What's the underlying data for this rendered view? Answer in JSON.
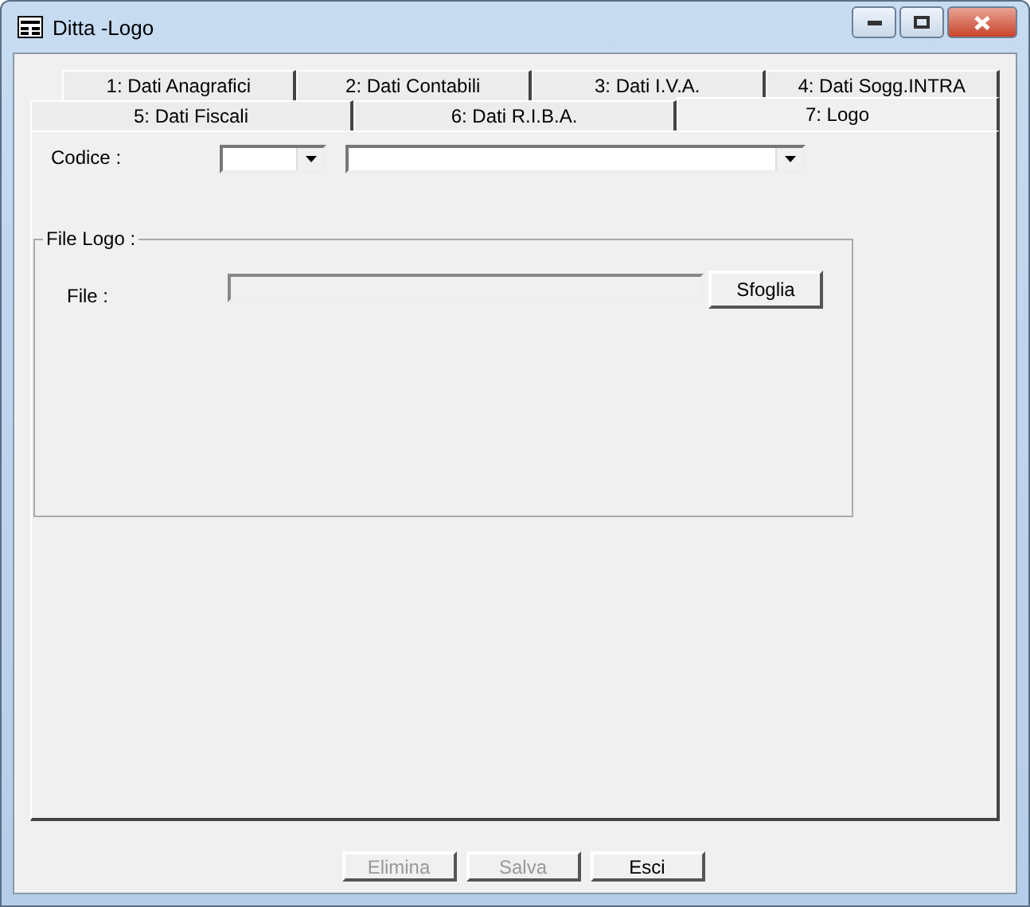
{
  "window": {
    "title": "Ditta -Logo"
  },
  "tab_rows": [
    [
      {
        "label": "1: Dati Anagrafici",
        "selected": false
      },
      {
        "label": "2: Dati Contabili",
        "selected": false
      },
      {
        "label": "3: Dati I.V.A.",
        "selected": false
      },
      {
        "label": "4: Dati Sogg.INTRA",
        "selected": false
      }
    ],
    [
      {
        "label": "5: Dati Fiscali",
        "selected": false
      },
      {
        "label": "6: Dati R.I.B.A.",
        "selected": false
      },
      {
        "label": "7: Logo",
        "selected": true
      }
    ]
  ],
  "codice": {
    "label": "Codice :"
  },
  "file_logo": {
    "title": "File Logo :",
    "file_label": "File :",
    "file_disabled": true,
    "browse_button": "Sfoglia"
  },
  "buttons": [
    {
      "label": "Elimina",
      "disabled": true
    },
    {
      "label": "Salva",
      "disabled": true
    },
    {
      "label": "Esci",
      "disabled": false
    }
  ]
}
